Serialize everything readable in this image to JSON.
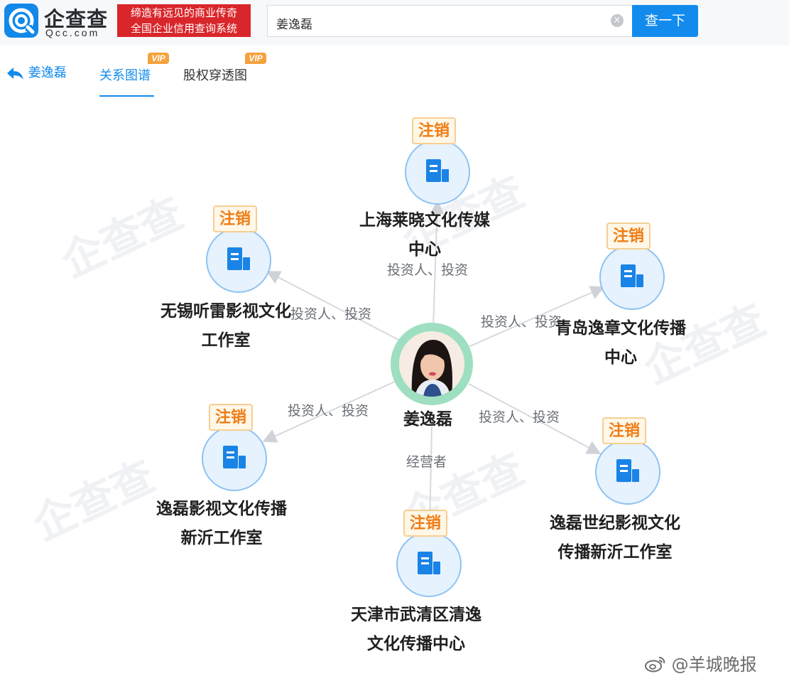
{
  "header": {
    "logo_name": "企查查",
    "logo_domain": "Qcc.com",
    "slogan_line1": "缔造有远见的商业传奇",
    "slogan_line2": "全国企业信用查询系统",
    "search_value": "姜逸磊",
    "search_button": "查一下",
    "clear_symbol": "×"
  },
  "tabs": {
    "back_label": "姜逸磊",
    "items": [
      {
        "label": "关系图谱",
        "vip": "VIP"
      },
      {
        "label": "股权穿透图",
        "vip": "VIP"
      }
    ]
  },
  "graph": {
    "watermark": "企查查",
    "person": {
      "name": "姜逸磊"
    },
    "badge_label": "注销",
    "companies": [
      {
        "line1": "上海莱晓文化传媒",
        "line2": "中心",
        "relation": "投资人、投资"
      },
      {
        "line1": "无锡听雷影视文化",
        "line2": "工作室",
        "relation": "投资人、投资"
      },
      {
        "line1": "青岛逸章文化传播",
        "line2": "中心",
        "relation": "投资人、投资"
      },
      {
        "line1": "逸磊影视文化传播",
        "line2": "新沂工作室",
        "relation": "投资人、投资"
      },
      {
        "line1": "逸磊世纪影视文化",
        "line2": "传播新沂工作室",
        "relation": "投资人、投资"
      },
      {
        "line1": "天津市武清区清逸",
        "line2": "文化传播中心",
        "relation": "经营者"
      }
    ]
  },
  "footer": {
    "weibo_tag": "@羊城晚报"
  },
  "colors": {
    "brand": "#128bed",
    "slogan_bg": "#d9262b",
    "badge": "#ef7d15",
    "node_border": "#8ec3f2",
    "center_ring": "#9ddfc0"
  }
}
